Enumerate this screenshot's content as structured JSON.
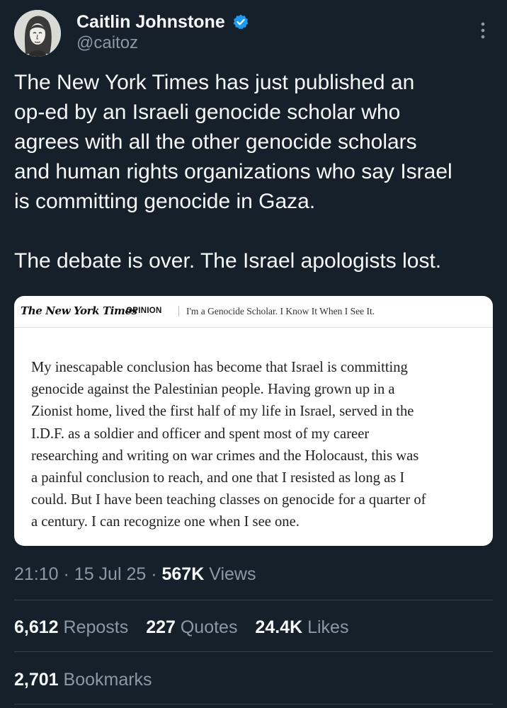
{
  "author": {
    "display_name": "Caitlin Johnstone",
    "handle": "@caitoz",
    "verified": true,
    "avatar_icon": "illustrated-portrait-avatar"
  },
  "tweet": {
    "text": "The New York Times has just published an\nop-ed by an Israeli genocide scholar who\nagrees with all the other genocide scholars\nand human rights organizations who say Israel\nis committing genocide in Gaza.\n\nThe debate is over. The Israel apologists lost."
  },
  "card": {
    "publication": "The New York Times",
    "section": "OPINION",
    "headline": "I'm a Genocide Scholar. I Know It When I See It.",
    "excerpt": "My inescapable conclusion has become that Israel is committing\ngenocide against the Palestinian people. Having grown up in a\nZionist home, lived the first half of my life in Israel, served in the\nI.D.F. as a soldier and officer and spent most of my career\nresearching and writing on war crimes and the Holocaust, this was\na painful conclusion to reach, and one that I resisted as long as I\ncould. But I have been teaching classes on genocide for a quarter of\na century. I can recognize one when I see one."
  },
  "meta": {
    "time": "21:10",
    "separator": "·",
    "date": "15 Jul 25",
    "views_count": "567K",
    "views_label": "Views"
  },
  "stats": {
    "reposts_count": "6,612",
    "reposts_label": "Reposts",
    "quotes_count": "227",
    "quotes_label": "Quotes",
    "likes_count": "24.4K",
    "likes_label": "Likes",
    "bookmarks_count": "2,701",
    "bookmarks_label": "Bookmarks"
  },
  "colors": {
    "background": "#15202b",
    "text_primary": "#f7f9f9",
    "text_secondary": "#8b98a5",
    "verified_blue": "#1d9bf0",
    "divider": "#38444d",
    "card_background": "#ffffff"
  },
  "icons": {
    "verified": "verified-badge-icon",
    "more": "more-options-icon"
  }
}
